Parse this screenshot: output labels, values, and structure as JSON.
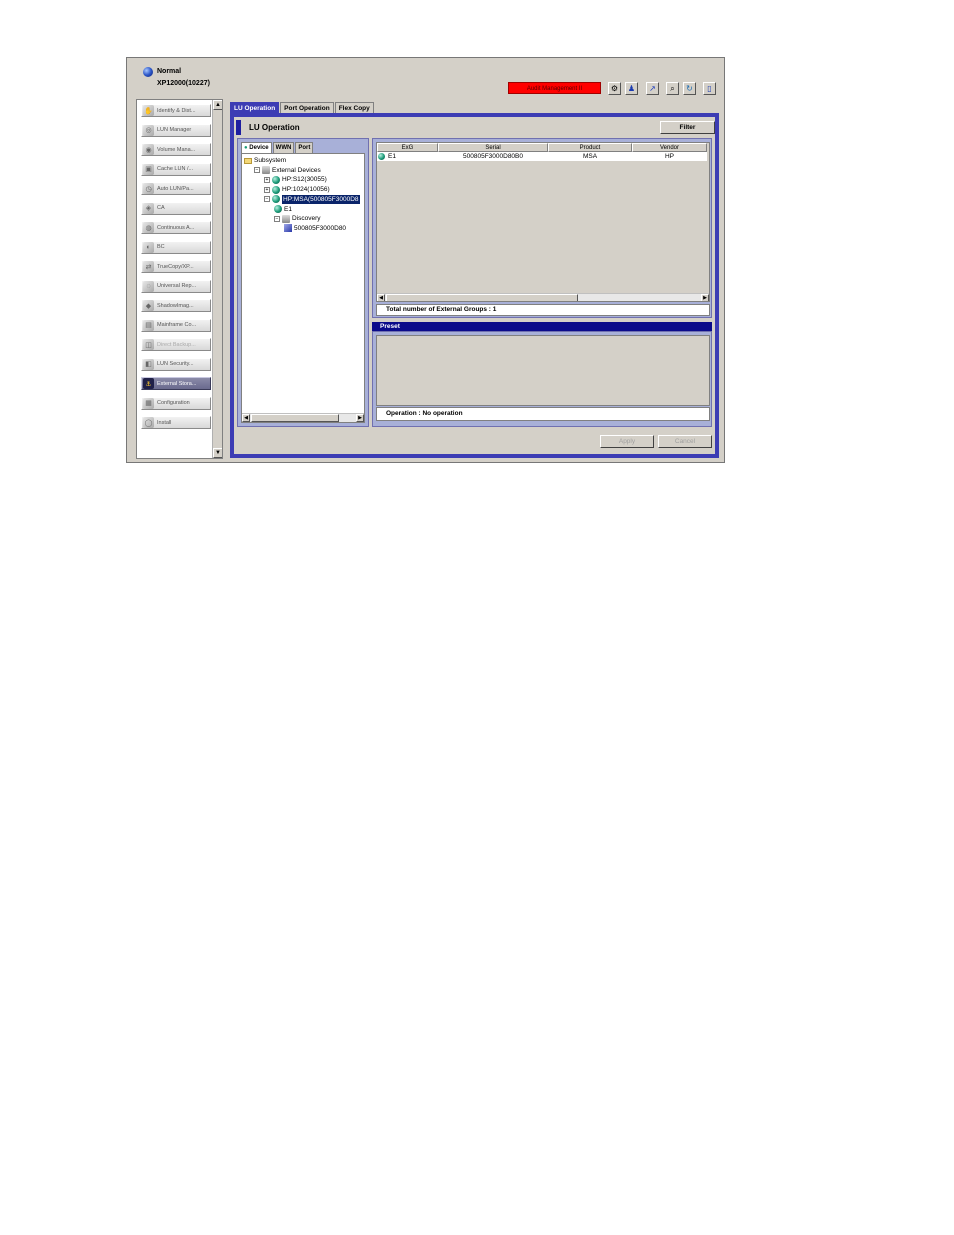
{
  "header": {
    "status": "Normal",
    "device": "XP12000(10227)",
    "mode_badge": "Audit Management II",
    "mode_color": "#ff0000"
  },
  "toolbar": {
    "icons": [
      "gear-icon",
      "users-icon",
      "graph-icon",
      "search-icon",
      "refresh-icon",
      "help-icon"
    ]
  },
  "sidebar": {
    "items": [
      {
        "label": "Identify & Dist...",
        "icon": "identify-icon",
        "state": "normal"
      },
      {
        "label": "LUN Manager",
        "icon": "lun-manager-icon",
        "state": "normal"
      },
      {
        "label": "Volume Mana...",
        "icon": "volume-manager-icon",
        "state": "normal"
      },
      {
        "label": "Cache LUN /...",
        "icon": "cache-lun-icon",
        "state": "normal"
      },
      {
        "label": "Auto LUN/Pa...",
        "icon": "auto-lun-icon",
        "state": "normal"
      },
      {
        "label": "CA",
        "icon": "ca-icon",
        "state": "normal"
      },
      {
        "label": "Continuous A...",
        "icon": "continuous-access-icon",
        "state": "normal"
      },
      {
        "label": "BC",
        "icon": "bc-icon",
        "state": "normal"
      },
      {
        "label": "TrueCopy/XP...",
        "icon": "truecopy-icon",
        "state": "normal"
      },
      {
        "label": "Universal Rep...",
        "icon": "universal-replicator-icon",
        "state": "normal"
      },
      {
        "label": "ShadowImag...",
        "icon": "shadowimage-icon",
        "state": "normal"
      },
      {
        "label": "Mainframe Co...",
        "icon": "mainframe-icon",
        "state": "normal"
      },
      {
        "label": "Direct Backup...",
        "icon": "backup-icon",
        "state": "disabled"
      },
      {
        "label": "LUN Security...",
        "icon": "lun-security-icon",
        "state": "normal"
      },
      {
        "label": "External Stora...",
        "icon": "external-storage-icon",
        "state": "selected"
      },
      {
        "label": "Configuration",
        "icon": "configuration-icon",
        "state": "normal"
      },
      {
        "label": "Install",
        "icon": "install-icon",
        "state": "normal"
      }
    ]
  },
  "tabs": [
    "LU Operation",
    "Port Operation",
    "Flex Copy"
  ],
  "panel": {
    "title": "LU Operation",
    "filter_label": "Filter",
    "subtabs": [
      "Device",
      "WWN",
      "Port"
    ]
  },
  "tree": {
    "nodes": [
      {
        "label": "Subsystem",
        "depth": 0,
        "icon": "folder",
        "expander": ""
      },
      {
        "label": "External Devices",
        "depth": 1,
        "icon": "disc",
        "expander": "-"
      },
      {
        "label": "HP:S12(30055)",
        "depth": 2,
        "icon": "globe",
        "expander": "+"
      },
      {
        "label": "HP:1024(10056)",
        "depth": 2,
        "icon": "globe",
        "expander": "+"
      },
      {
        "label": "HP:MSA(500805F3000D8",
        "depth": 2,
        "icon": "globe",
        "expander": "-",
        "selected": true
      },
      {
        "label": "E1",
        "depth": 3,
        "icon": "globe",
        "expander": ""
      },
      {
        "label": "Discovery",
        "depth": 3,
        "icon": "disc",
        "expander": "-"
      },
      {
        "label": "500805F3000D80",
        "depth": 4,
        "icon": "cube",
        "expander": ""
      }
    ]
  },
  "table": {
    "columns": [
      "ExG",
      "Serial",
      "Product",
      "Vendor"
    ],
    "rows": [
      {
        "exg": "E1",
        "serial": "500805F3000D80B0",
        "product": "MSA",
        "vendor": "HP"
      }
    ],
    "total_text": "Total number of External Groups : 1"
  },
  "preset": {
    "title": "Preset",
    "operation_text": "Operation : No operation"
  },
  "actions": {
    "apply_label": "Apply",
    "cancel_label": "Cancel"
  }
}
